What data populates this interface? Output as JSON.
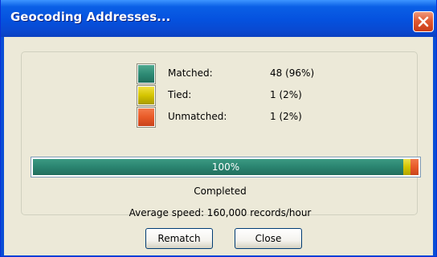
{
  "window": {
    "title": "Geocoding Addresses..."
  },
  "legend": [
    {
      "label": "Matched:",
      "value": "48 (96%)",
      "color": "#2e8b75"
    },
    {
      "label": "Tied:",
      "value": "1 (2%)",
      "color": "#d4c400"
    },
    {
      "label": "Unmatched:",
      "value": "1 (2%)",
      "color": "#e85a28"
    }
  ],
  "progress": {
    "label": "100%",
    "segments": [
      {
        "name": "matched",
        "fraction": 0.96,
        "color": "#2e8b75"
      },
      {
        "name": "tied",
        "fraction": 0.02,
        "color": "#d4c400"
      },
      {
        "name": "unmatched",
        "fraction": 0.02,
        "color": "#e85a28"
      }
    ]
  },
  "status": "Completed",
  "speed": "Average speed: 160,000 records/hour",
  "buttons": {
    "rematch": "Rematch",
    "close": "Close"
  },
  "icons": {
    "close": "close-icon"
  }
}
